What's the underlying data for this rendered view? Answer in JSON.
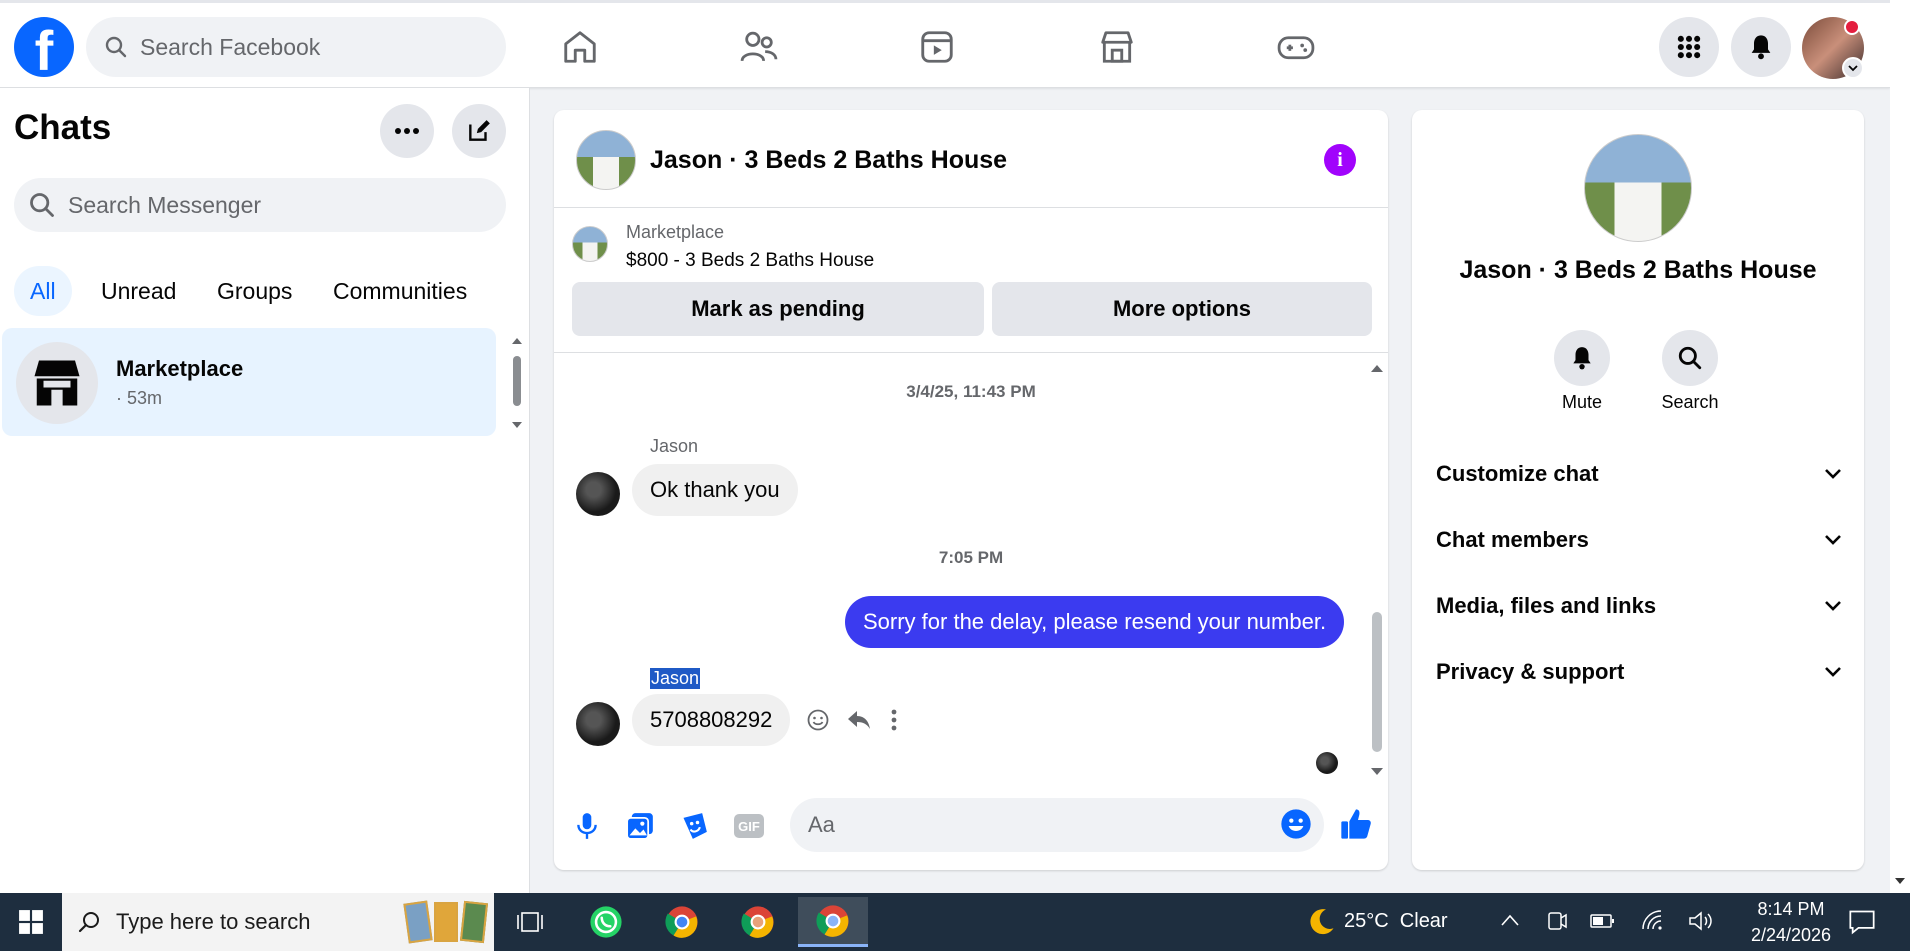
{
  "topbar": {
    "search_placeholder": "Search Facebook",
    "logo_letter": "f"
  },
  "sidebar": {
    "title": "Chats",
    "search_placeholder": "Search Messenger",
    "filters": [
      "All",
      "Unread",
      "Groups",
      "Communities"
    ],
    "conversation": {
      "name": "Marketplace",
      "time": "· 53m"
    }
  },
  "chat": {
    "title": "Jason · 3 Beds 2 Baths House",
    "info_icon_glyph": "i",
    "marketplace_label": "Marketplace",
    "listing": "$800 - 3 Beds 2 Baths House",
    "mark_pending": "Mark as pending",
    "more_options": "More options",
    "messages": {
      "ts1": "3/4/25, 11:43 PM",
      "sender1": "Jason",
      "msg1": "Ok thank you",
      "ts2": "7:05 PM",
      "msg2": "Sorry for the delay, please resend your number.",
      "sender2": "Jason",
      "msg3": "5708808292"
    },
    "composer_placeholder": "Aa",
    "gif_label": "GIF"
  },
  "info_panel": {
    "name": "Jason · 3 Beds 2 Baths House",
    "mute_label": "Mute",
    "search_label": "Search",
    "sections": [
      "Customize chat",
      "Chat members",
      "Media, files and links",
      "Privacy & support"
    ]
  },
  "taskbar": {
    "search_placeholder": "Type here to search",
    "weather": "25°C  Clear",
    "time": "8:14 PM",
    "date": "2/24/2026"
  },
  "colors": {
    "brand": "#0866ff",
    "outgoing_bubble": "#3b3bf0",
    "info_icon": "#a103fc"
  }
}
